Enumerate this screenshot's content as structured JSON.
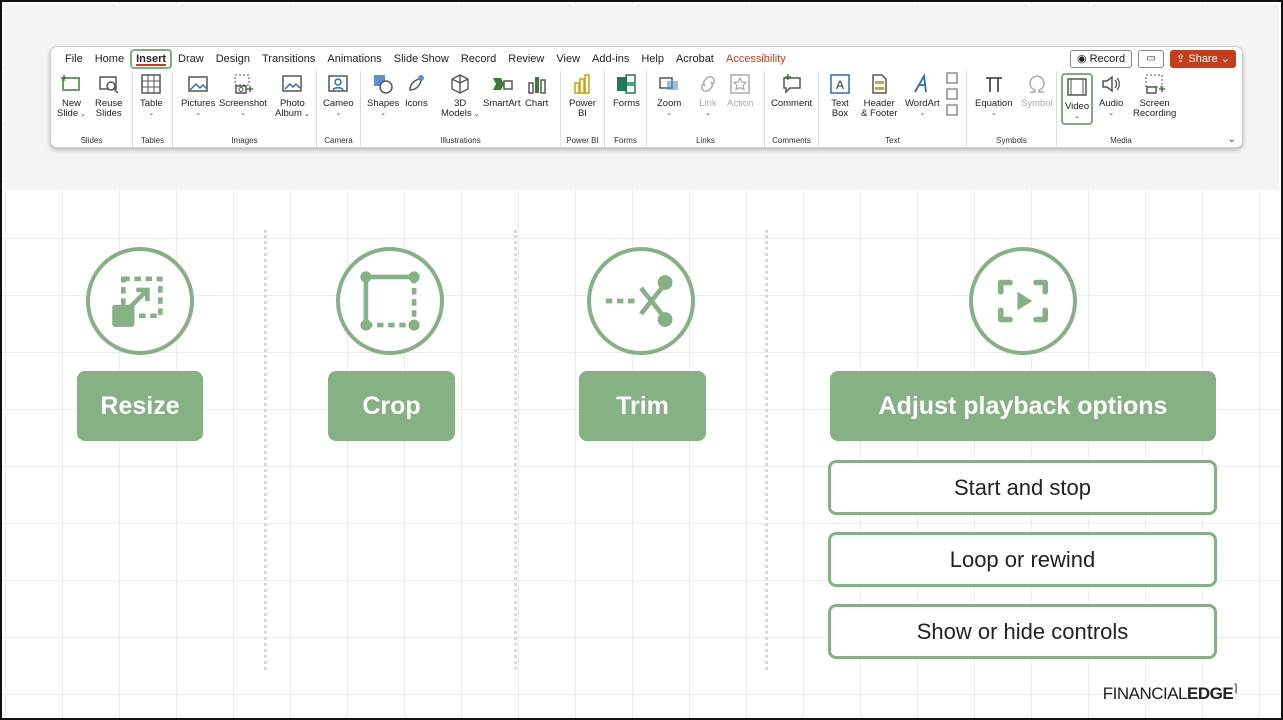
{
  "ribbon": {
    "menu": [
      "File",
      "Home",
      "Insert",
      "Draw",
      "Design",
      "Transitions",
      "Animations",
      "Slide Show",
      "Record",
      "Review",
      "View",
      "Add-ins",
      "Help",
      "Acrobat",
      "Accessibility"
    ],
    "record_label": "Record",
    "share_label": "Share",
    "groups": {
      "slides": "Slides",
      "tables": "Tables",
      "images": "Images",
      "camera": "Camera",
      "illustrations": "Illustrations",
      "powerbi": "Power BI",
      "forms": "Forms",
      "links": "Links",
      "comments": "Comments",
      "text": "Text",
      "symbols": "Symbols",
      "media": "Media"
    },
    "buttons": {
      "new_slide": [
        "New",
        "Slide"
      ],
      "reuse_slides": [
        "Reuse",
        "Slides"
      ],
      "table": "Table",
      "pictures": "Pictures",
      "screenshot": "Screenshot",
      "photo_album": [
        "Photo",
        "Album"
      ],
      "cameo": "Cameo",
      "shapes": "Shapes",
      "icons": "Icons",
      "models_3d": [
        "3D",
        "Models"
      ],
      "smartart": "SmartArt",
      "chart": "Chart",
      "power_bi": [
        "Power",
        "BI"
      ],
      "forms": "Forms",
      "zoom": "Zoom",
      "link": "Link",
      "action": "Action",
      "comment": "Comment",
      "text_box": [
        "Text",
        "Box"
      ],
      "header_footer": [
        "Header",
        "& Footer"
      ],
      "wordart": "WordArt",
      "equation": "Equation",
      "symbol": "Symbol",
      "video": "Video",
      "audio": "Audio",
      "screen_recording": [
        "Screen",
        "Recording"
      ]
    }
  },
  "features": [
    {
      "label": "Resize",
      "icon": "resize-icon"
    },
    {
      "label": "Crop",
      "icon": "crop-icon"
    },
    {
      "label": "Trim",
      "icon": "trim-scissors-icon"
    },
    {
      "label": "Adjust playback options",
      "icon": "playback-icon"
    }
  ],
  "playback_options": [
    "Start and stop",
    "Loop or rewind",
    "Show or hide controls"
  ],
  "logo": {
    "light": "FINANCIAL",
    "bold": "EDGE"
  },
  "colors": {
    "accent_green": "#86b184",
    "ribbon_accent": "#c43e1c"
  }
}
